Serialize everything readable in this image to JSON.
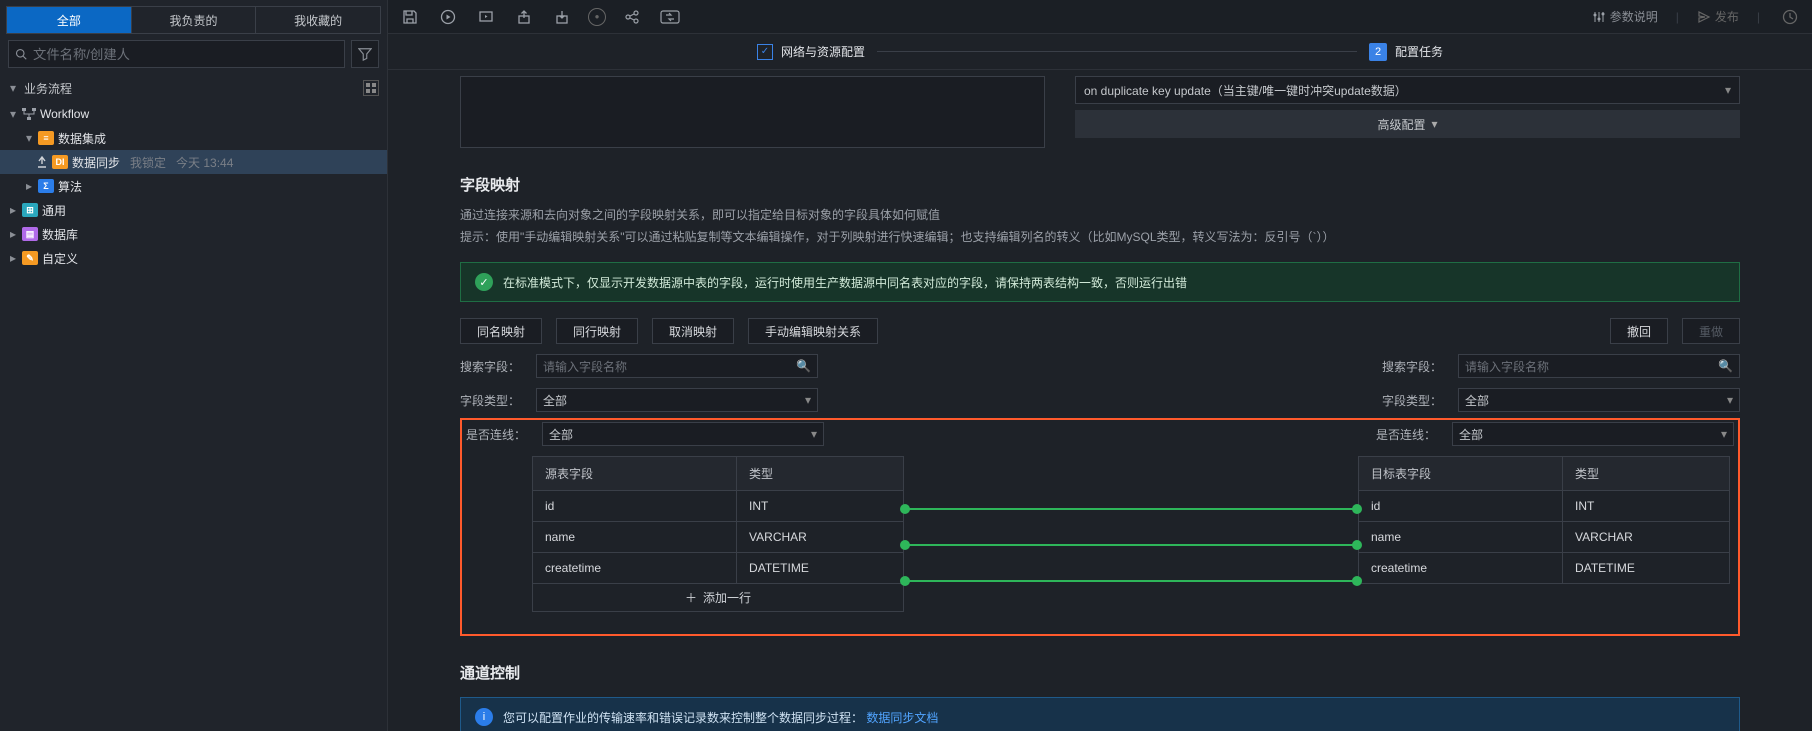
{
  "sidebar": {
    "tabs": {
      "all": "全部",
      "mine": "我负责的",
      "fav": "我收藏的"
    },
    "search_placeholder": "文件名称/创建人",
    "section": "业务流程",
    "tree": {
      "workflow": "Workflow",
      "data_integration": "数据集成",
      "data_sync": "数据同步",
      "data_sync_lock": "我锁定",
      "data_sync_time": "今天 13:44",
      "algorithm": "算法",
      "general": "通用",
      "database": "数据库",
      "custom": "自定义"
    }
  },
  "toolbar_right": {
    "params": "参数说明",
    "publish": "发布"
  },
  "stepper": {
    "step1": "网络与资源配置",
    "step2_num": "2",
    "step2": "配置任务"
  },
  "upper": {
    "pk_update_option": "on duplicate key update（当主键/唯一键时冲突update数据）",
    "advanced": "高级配置"
  },
  "field_map": {
    "title": "字段映射",
    "desc1": "通过连接来源和去向对象之间的字段映射关系，即可以指定给目标对象的字段具体如何赋值",
    "desc2": "提示：使用\"手动编辑映射关系\"可以通过粘贴复制等文本编辑操作，对于列映射进行快速编辑；也支持编辑列名的转义（比如MySQL类型，转义写法为：反引号（`））",
    "alert": "在标准模式下，仅显示开发数据源中表的字段，运行时使用生产数据源中同名表对应的字段，请保持两表结构一致，否则运行出错",
    "buttons": {
      "same_name": "同名映射",
      "same_row": "同行映射",
      "cancel": "取消映射",
      "manual": "手动编辑映射关系",
      "undo": "撤回",
      "redo": "重做"
    },
    "filter_labels": {
      "search_field": "搜索字段：",
      "field_type": "字段类型：",
      "is_linked": "是否连线："
    },
    "filter_values": {
      "search_placeholder": "请输入字段名称",
      "all": "全部"
    },
    "source": {
      "header_field": "源表字段",
      "header_type": "类型",
      "rows": [
        {
          "f": "id",
          "t": "INT"
        },
        {
          "f": "name",
          "t": "VARCHAR"
        },
        {
          "f": "createtime",
          "t": "DATETIME"
        }
      ],
      "add_row": "添加一行"
    },
    "target": {
      "header_field": "目标表字段",
      "header_type": "类型",
      "rows": [
        {
          "f": "id",
          "t": "INT"
        },
        {
          "f": "name",
          "t": "VARCHAR"
        },
        {
          "f": "createtime",
          "t": "DATETIME"
        }
      ]
    }
  },
  "channel": {
    "title": "通道控制",
    "alert_pre": "您可以配置作业的传输速率和错误记录数来控制整个数据同步过程：",
    "alert_link": "数据同步文档"
  }
}
